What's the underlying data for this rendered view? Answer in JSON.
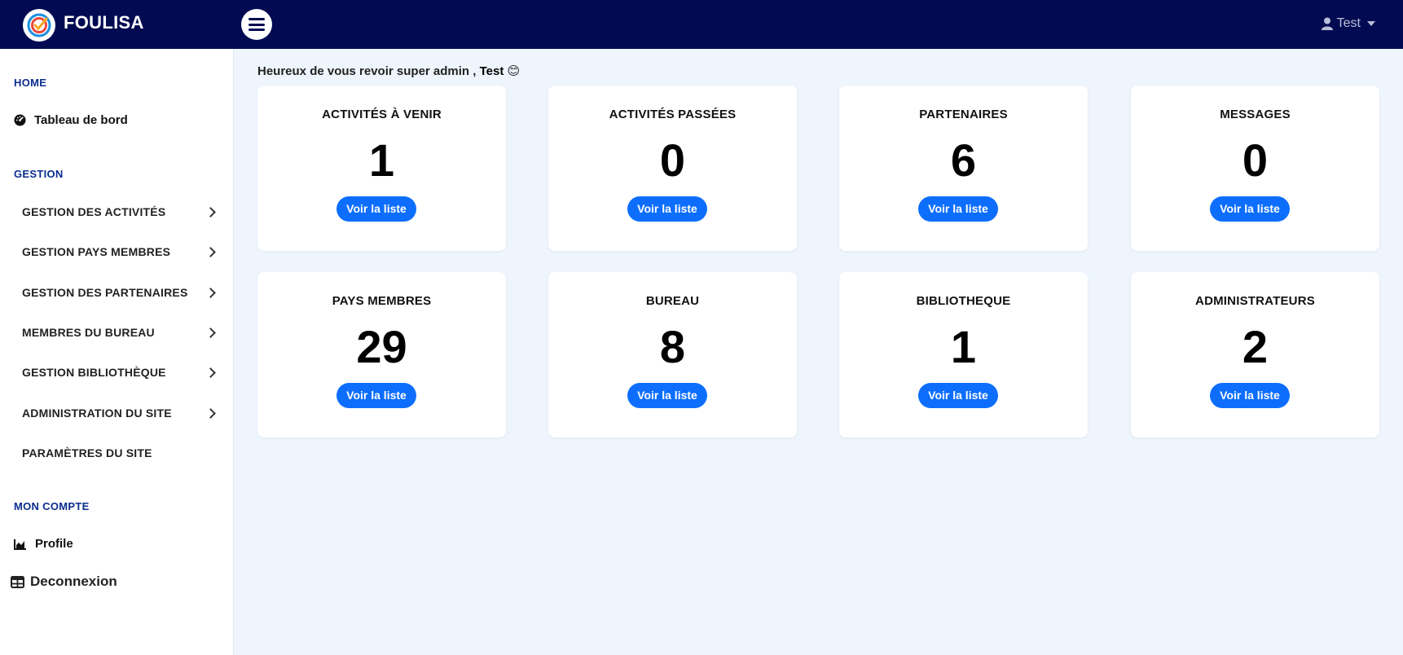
{
  "header": {
    "brand": "FOULISA",
    "user_label": "Test"
  },
  "sidebar": {
    "section_home": "HOME",
    "dashboard": "Tableau de bord",
    "section_gestion": "GESTION",
    "gestion_items": [
      {
        "label": "GESTION DES ACTIVITÉS",
        "has_submenu": true
      },
      {
        "label": "GESTION PAYS MEMBRES",
        "has_submenu": true
      },
      {
        "label": "GESTION DES PARTENAIRES",
        "has_submenu": true
      },
      {
        "label": "MEMBRES DU BUREAU",
        "has_submenu": true
      },
      {
        "label": "GESTION BIBLIOTHÈQUE",
        "has_submenu": true
      },
      {
        "label": "ADMINISTRATION DU SITE",
        "has_submenu": true
      },
      {
        "label": "PARAMÈTRES DU SITE",
        "has_submenu": false
      }
    ],
    "section_compte": "MON COMPTE",
    "profile": "Profile",
    "logout": "Deconnexion"
  },
  "main": {
    "greeting_prefix": "Heureux de vous revoir super admin ,",
    "greeting_name": "Test",
    "greeting_emoji": "😊",
    "cards": [
      {
        "title": "ACTIVITÉS À VENIR",
        "value": "1",
        "button": "Voir la liste"
      },
      {
        "title": "ACTIVITÉS PASSÉES",
        "value": "0",
        "button": "Voir la liste"
      },
      {
        "title": "PARTENAIRES",
        "value": "6",
        "button": "Voir la liste"
      },
      {
        "title": "MESSAGES",
        "value": "0",
        "button": "Voir la liste"
      },
      {
        "title": "PAYS MEMBRES",
        "value": "29",
        "button": "Voir la liste"
      },
      {
        "title": "BUREAU",
        "value": "8",
        "button": "Voir la liste"
      },
      {
        "title": "BIBLIOTHEQUE",
        "value": "1",
        "button": "Voir la liste"
      },
      {
        "title": "ADMINISTRATEURS",
        "value": "2",
        "button": "Voir la liste"
      }
    ]
  },
  "colors": {
    "topbar": "#020b52",
    "section_heading": "#0b2d8f",
    "button": "#0d6efd",
    "page_background": "#eef5fd"
  },
  "icons": {
    "logo": "check-circle-logo",
    "menu": "hamburger-icon",
    "user": "user-icon",
    "dashboard": "speedometer-icon",
    "profile": "area-chart-icon",
    "logout": "table-icon"
  }
}
